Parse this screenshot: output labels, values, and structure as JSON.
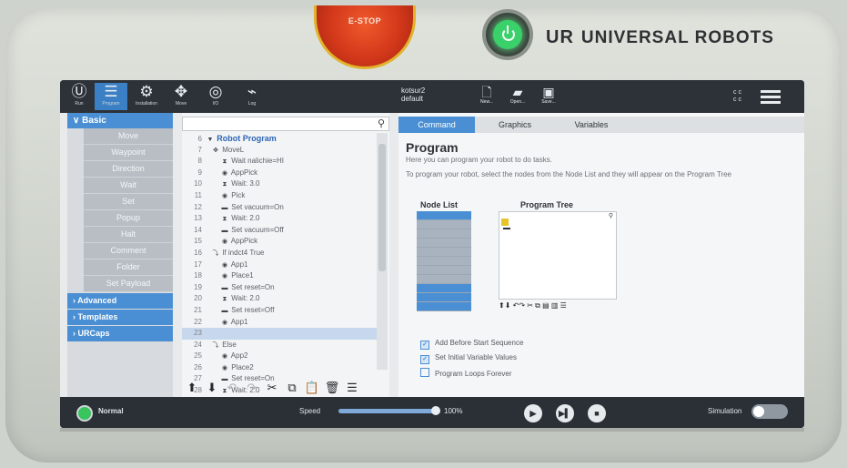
{
  "device": {
    "estop_label": "E-STOP",
    "brand_logo": "UR",
    "brand_name": "UNIVERSAL ROBOTS"
  },
  "topbar": {
    "nav": [
      {
        "label": "Run",
        "icon": "run-icon"
      },
      {
        "label": "Program",
        "icon": "program-icon"
      },
      {
        "label": "Installation",
        "icon": "installation-icon"
      },
      {
        "label": "Move",
        "icon": "move-icon"
      },
      {
        "label": "I/O",
        "icon": "io-icon"
      },
      {
        "label": "Log",
        "icon": "log-icon"
      }
    ],
    "file_name": "kotsur2",
    "installation": "default",
    "actions": [
      {
        "label": "New...",
        "icon": "new-file-icon"
      },
      {
        "label": "Open...",
        "icon": "open-folder-icon"
      },
      {
        "label": "Save...",
        "icon": "save-icon"
      }
    ],
    "cc_lines": [
      "c c",
      "c c"
    ],
    "accent": "#4a8fd3"
  },
  "sidebar": {
    "header": "Basic",
    "items": [
      "Move",
      "Waypoint",
      "Direction",
      "Wait",
      "Set",
      "Popup",
      "Halt",
      "Comment",
      "Folder",
      "Set Payload"
    ],
    "categories": [
      "Advanced",
      "Templates",
      "URCaps"
    ]
  },
  "tree": {
    "rows": [
      {
        "num": "6",
        "icon": "▼",
        "text": "Robot Program"
      },
      {
        "num": "7",
        "icon": "✥",
        "text": "MoveL"
      },
      {
        "num": "8",
        "icon": "⧗",
        "text": "Wait nalichie=HI"
      },
      {
        "num": "9",
        "icon": "◉",
        "text": "AppPick"
      },
      {
        "num": "10",
        "icon": "⧗",
        "text": "Wait: 3.0"
      },
      {
        "num": "11",
        "icon": "◉",
        "text": "Pick"
      },
      {
        "num": "12",
        "icon": "▬",
        "text": "Set vacuum=On"
      },
      {
        "num": "13",
        "icon": "⧗",
        "text": "Wait: 2.0"
      },
      {
        "num": "14",
        "icon": "▬",
        "text": "Set vacuum=Off"
      },
      {
        "num": "15",
        "icon": "◉",
        "text": "AppPick"
      },
      {
        "num": "16",
        "icon": "⤵",
        "text": "If indct4 True"
      },
      {
        "num": "17",
        "icon": "◉",
        "text": "App1"
      },
      {
        "num": "18",
        "icon": "◉",
        "text": "Place1"
      },
      {
        "num": "19",
        "icon": "▬",
        "text": "Set reset=On"
      },
      {
        "num": "20",
        "icon": "⧗",
        "text": "Wait: 2.0"
      },
      {
        "num": "21",
        "icon": "▬",
        "text": "Set reset=Off"
      },
      {
        "num": "22",
        "icon": "◉",
        "text": "App1"
      },
      {
        "num": "23",
        "icon": "",
        "text": ""
      },
      {
        "num": "24",
        "icon": "⤵",
        "text": "Else"
      },
      {
        "num": "25",
        "icon": "◉",
        "text": "App2"
      },
      {
        "num": "26",
        "icon": "◉",
        "text": "Place2"
      },
      {
        "num": "27",
        "icon": "▬",
        "text": "Set reset=On"
      },
      {
        "num": "28",
        "icon": "⧗",
        "text": "Wait: 2.0"
      }
    ],
    "toolbar": [
      "⬆",
      "⬇",
      "↶",
      "↷",
      "✂",
      "⧉",
      "📋",
      "🗑",
      "☰"
    ]
  },
  "main": {
    "tabs": [
      "Command",
      "Graphics",
      "Variables"
    ],
    "title": "Program",
    "intro": "Here you can program your robot to do tasks.",
    "instructions": "To program your robot, select the nodes from the Node List and they will appear on the Program Tree",
    "node_list_title": "Node List",
    "program_tree_title": "Program Tree",
    "checkboxes": [
      {
        "label": "Add Before Start Sequence",
        "checked": true
      },
      {
        "label": "Set Initial Variable Values",
        "checked": true
      },
      {
        "label": "Program Loops Forever",
        "checked": false
      }
    ]
  },
  "footer": {
    "mode": "Normal",
    "speed_label": "Speed",
    "speed_value": "100%",
    "speed_fraction": 1.0,
    "simulation_label": "Simulation",
    "simulation_on": false
  }
}
